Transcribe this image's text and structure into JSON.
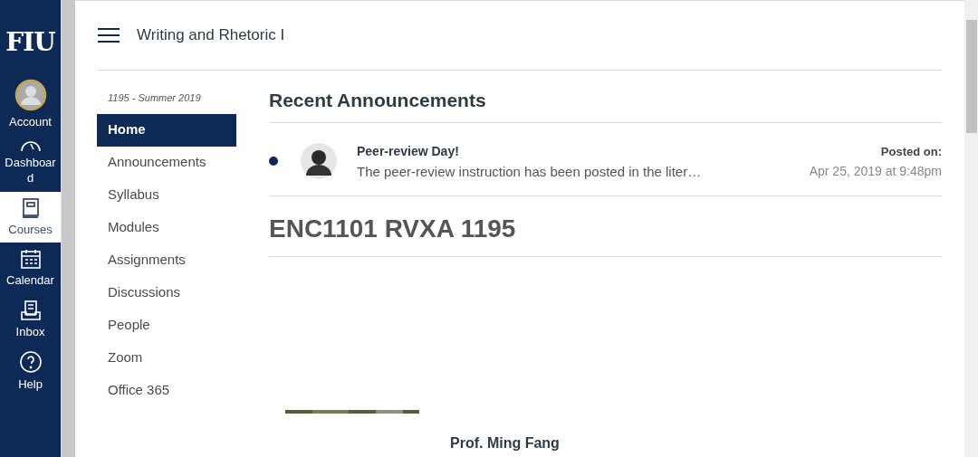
{
  "global_nav": {
    "logo": "FIU",
    "items": [
      {
        "kind": "account",
        "label": "Account",
        "selected": false
      },
      {
        "kind": "dashboard",
        "label": "Dashboar d",
        "selected": false
      },
      {
        "kind": "courses",
        "label": "Courses",
        "selected": true
      },
      {
        "kind": "calendar",
        "label": "Calendar",
        "selected": false
      },
      {
        "kind": "inbox",
        "label": "Inbox",
        "selected": false
      },
      {
        "kind": "help",
        "label": "Help",
        "selected": false
      }
    ]
  },
  "header": {
    "title": "Writing and Rhetoric I"
  },
  "course_nav": {
    "term": "1195 - Summer 2019",
    "items": [
      {
        "label": "Home",
        "selected": true
      },
      {
        "label": "Announcements",
        "selected": false
      },
      {
        "label": "Syllabus",
        "selected": false
      },
      {
        "label": "Modules",
        "selected": false
      },
      {
        "label": "Assignments",
        "selected": false
      },
      {
        "label": "Discussions",
        "selected": false
      },
      {
        "label": "People",
        "selected": false
      },
      {
        "label": "Zoom",
        "selected": false
      },
      {
        "label": "Office 365",
        "selected": false
      }
    ]
  },
  "announcements": {
    "title": "Recent Announcements",
    "items": [
      {
        "title": "Peer-review Day!",
        "excerpt": "The peer-review instruction has been posted in the liter…",
        "unread": true,
        "posted_label": "Posted on:",
        "posted_date": "Apr 25, 2019 at 9:48pm"
      }
    ]
  },
  "course": {
    "heading": "ENC1101 RVXA 1195",
    "instructor": "Prof. Ming Fang"
  }
}
